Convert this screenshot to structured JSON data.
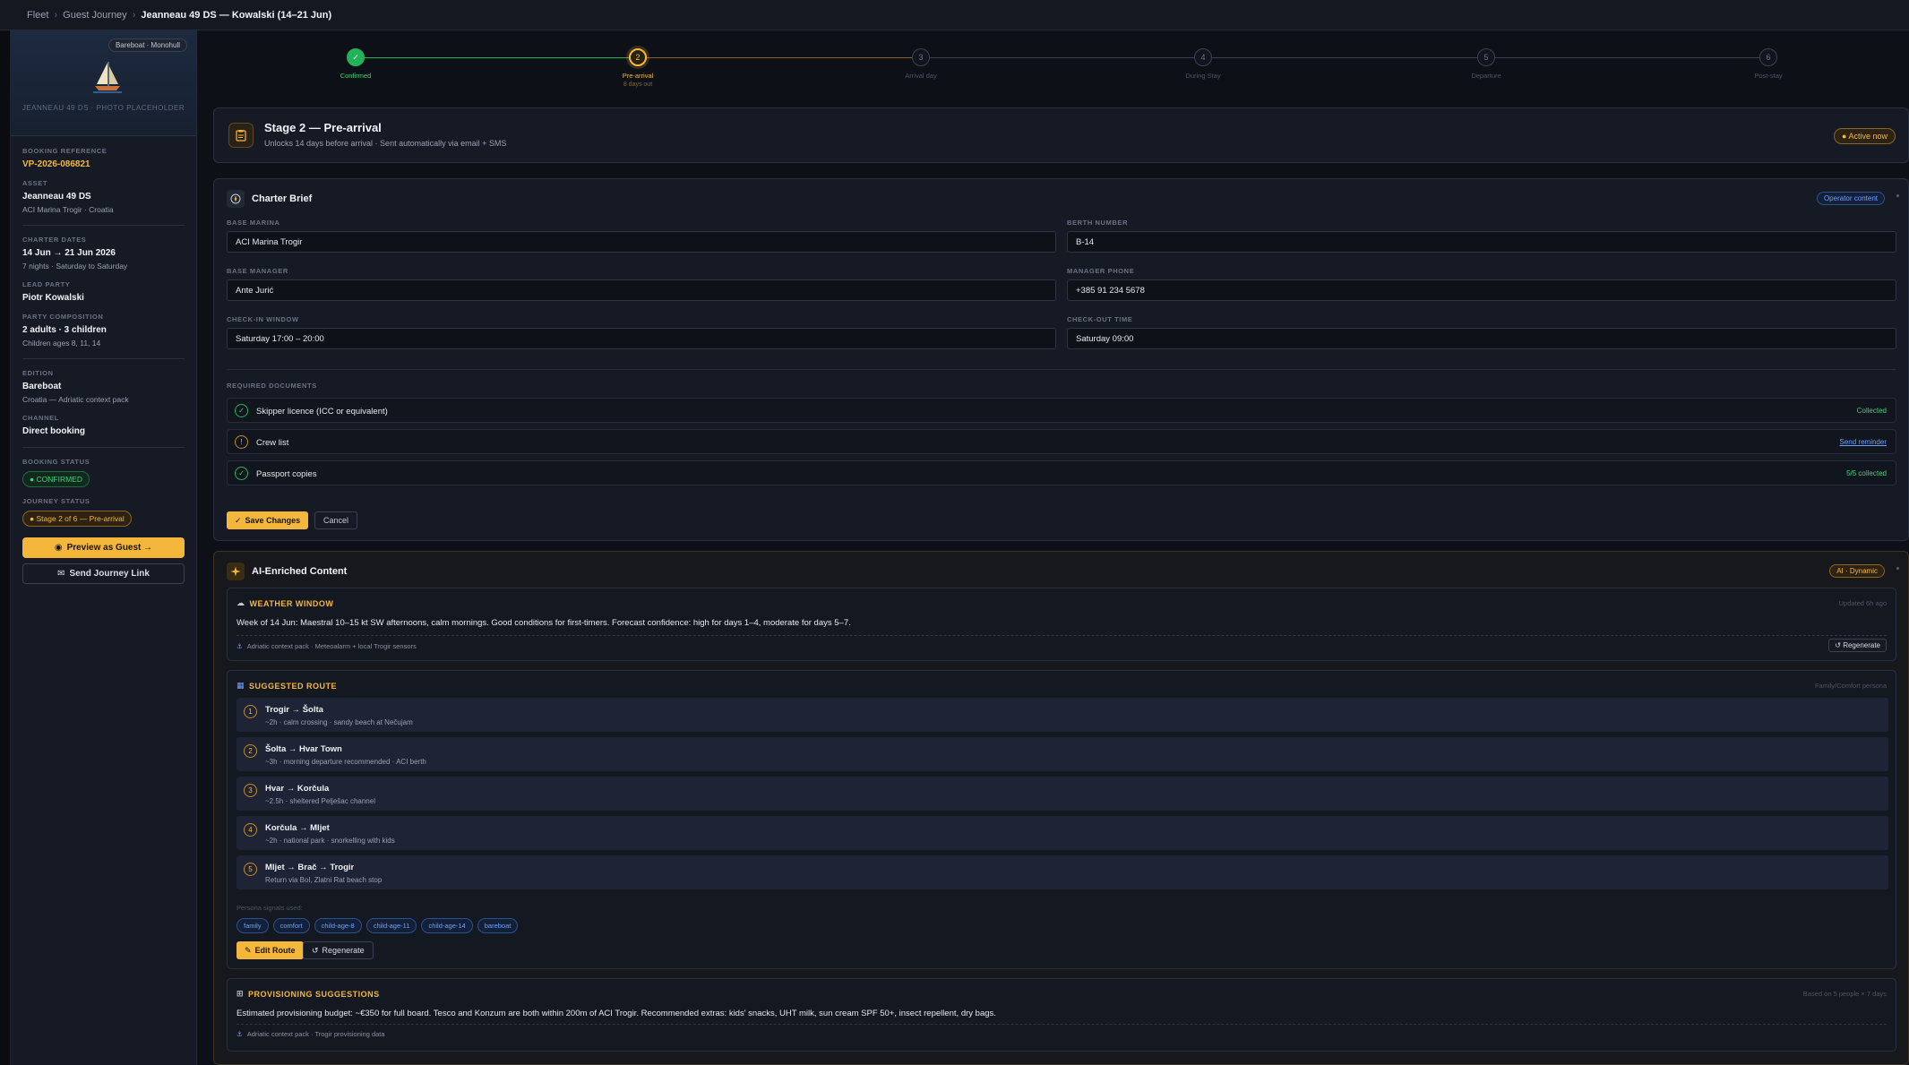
{
  "breadcrumb": [
    "Fleet",
    "Guest Journey",
    "Jeanneau 49 DS — Kowalski (14–21 Jun)"
  ],
  "sidebar": {
    "type_badge": "Bareboat · Monohull",
    "photo_placeholder": "JEANNEAU 49 DS · PHOTO PLACEHOLDER",
    "booking_reference_label": "BOOKING REFERENCE",
    "booking_reference": "VP-2026-086821",
    "asset_label": "ASSET",
    "asset": "Jeanneau 49 DS",
    "asset_sub": "ACI Marina Trogir · Croatia",
    "charter_dates_label": "CHARTER DATES",
    "charter_dates": "14 Jun → 21 Jun 2026",
    "charter_dates_sub": "7 nights · Saturday to Saturday",
    "lead_party_label": "LEAD PARTY",
    "lead_party": "Piotr Kowalski",
    "party_label": "PARTY COMPOSITION",
    "party": "2 adults · 3 children",
    "party_sub": "Children ages 8, 11, 14",
    "edition_label": "EDITION",
    "edition": "Bareboat",
    "edition_sub": "Croatia — Adriatic context pack",
    "channel_label": "CHANNEL",
    "channel": "Direct booking",
    "booking_status_label": "BOOKING STATUS",
    "booking_status": "CONFIRMED",
    "journey_status_label": "JOURNEY STATUS",
    "journey_status": "Stage 2 of 6 — Pre-arrival",
    "preview_button": "Preview as Guest →",
    "send_link_button": "Send Journey Link"
  },
  "stepper": [
    {
      "num": "✓",
      "label": "Confirmed",
      "sub": "",
      "state": "done"
    },
    {
      "num": "2",
      "label": "Pre-arrival",
      "sub": "8 days out",
      "state": "active"
    },
    {
      "num": "3",
      "label": "Arrival day",
      "sub": "",
      "state": "todo"
    },
    {
      "num": "4",
      "label": "During Stay",
      "sub": "",
      "state": "todo"
    },
    {
      "num": "5",
      "label": "Departure",
      "sub": "",
      "state": "todo"
    },
    {
      "num": "6",
      "label": "Post-stay",
      "sub": "",
      "state": "todo"
    }
  ],
  "stage": {
    "title": "Stage 2 — Pre-arrival",
    "subtitle": "Unlocks 14 days before arrival · Sent automatically via email + SMS",
    "badge": "Active now"
  },
  "brief": {
    "title": "Charter Brief",
    "badge": "Operator content",
    "fields": {
      "base_marina_label": "BASE MARINA",
      "base_marina": "ACI Marina Trogir",
      "berth_label": "BERTH NUMBER",
      "berth": "B-14",
      "manager_label": "BASE MANAGER",
      "manager": "Ante Jurić",
      "phone_label": "MANAGER PHONE",
      "phone": "+385 91 234 5678",
      "checkin_label": "CHECK-IN WINDOW",
      "checkin": "Saturday 17:00 – 20:00",
      "checkout_label": "CHECK-OUT TIME",
      "checkout": "Saturday 09:00"
    },
    "docs_label": "REQUIRED DOCUMENTS",
    "docs": [
      {
        "name": "Skipper licence (ICC or equivalent)",
        "status": "Collected"
      },
      {
        "name": "Crew list",
        "status": "Send reminder"
      },
      {
        "name": "Passport copies",
        "status": "5/5 collected"
      }
    ],
    "save_button": "Save Changes",
    "cancel_button": "Cancel"
  },
  "ai": {
    "title": "AI-Enriched Content",
    "badge": "AI · Dynamic",
    "weather": {
      "title": "WEATHER WINDOW",
      "meta": "Updated 6h ago",
      "text": "Week of 14 Jun: Maestral 10–15 kt SW afternoons, calm mornings. Good conditions for first-timers. Forecast confidence: high for days 1–4, moderate for days 5–7.",
      "source": "Adriatic context pack · Meteoalarm + local Trogir sensors",
      "regen": "Regenerate"
    },
    "route": {
      "title": "SUGGESTED ROUTE",
      "meta": "Family/Comfort persona",
      "legs": [
        {
          "num": "1",
          "title": "Trogir → Šolta",
          "sub": "~2h · calm crossing · sandy beach at Nečujam"
        },
        {
          "num": "2",
          "title": "Šolta → Hvar Town",
          "sub": "~3h · morning departure recommended · ACI berth"
        },
        {
          "num": "3",
          "title": "Hvar → Korčula",
          "sub": "~2.5h · sheltered Pelješac channel"
        },
        {
          "num": "4",
          "title": "Korčula → Mljet",
          "sub": "~2h · national park · snorkelling with kids"
        },
        {
          "num": "5",
          "title": "Mljet → Brač → Trogir",
          "sub": "Return via Bol, Zlatni Rat beach stop"
        }
      ],
      "persona_label": "Persona signals used:",
      "tags": [
        "family",
        "comfort",
        "child-age-8",
        "child-age-11",
        "child-age-14",
        "bareboat"
      ],
      "edit_button": "Edit Route",
      "regen_button": "Regenerate"
    },
    "provisioning": {
      "title": "PROVISIONING SUGGESTIONS",
      "meta": "Based on 5 people × 7 days",
      "text": "Estimated provisioning budget: ~€350 for full board. Tesco and Konzum are both within 200m of ACI Trogir. Recommended extras: kids' snacks, UHT milk, sun cream SPF 50+, insect repellent, dry bags.",
      "source": "Adriatic context pack · Trogir provisioning data"
    }
  },
  "colors": {
    "accent": "#f5b73b",
    "success": "#22b35a",
    "info": "#6ea0ff",
    "bg": "#0d1016"
  }
}
